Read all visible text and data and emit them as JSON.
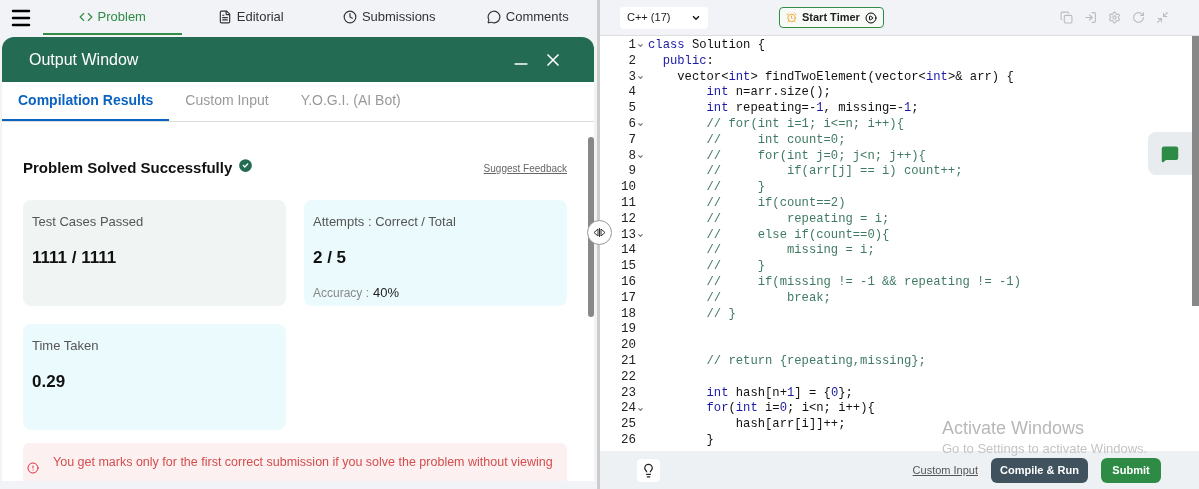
{
  "nav": {
    "tabs": [
      {
        "label": "Problem",
        "selected": true
      },
      {
        "label": "Editorial",
        "selected": false
      },
      {
        "label": "Submissions",
        "selected": false
      },
      {
        "label": "Comments",
        "selected": false
      }
    ]
  },
  "output_window": {
    "title": "Output Window",
    "tabs": [
      {
        "label": "Compilation Results",
        "selected": true
      },
      {
        "label": "Custom Input",
        "selected": false
      },
      {
        "label": "Y.O.G.I. (AI Bot)",
        "selected": false
      }
    ],
    "status": "Problem Solved Successfully",
    "feedback_link": "Suggest Feedback",
    "cards": [
      {
        "label": "Test Cases Passed",
        "value": "1111 / 1111"
      },
      {
        "label": "Attempts : Correct / Total",
        "value": "2 / 5",
        "extra_label": "Accuracy :",
        "extra_value": "40%"
      },
      {
        "label": "Time Taken",
        "value": "0.29"
      }
    ],
    "notice": "You get marks only for the first correct submission if you solve the problem without viewing"
  },
  "editor": {
    "language": "C++ (17)",
    "timer_button": "Start Timer",
    "lines": [
      {
        "number": "1",
        "fold": true,
        "tokens": [
          {
            "kind": "keyword",
            "text": "class"
          },
          {
            "kind": "plain",
            "text": " Solution {"
          }
        ]
      },
      {
        "number": "2",
        "fold": false,
        "tokens": [
          {
            "kind": "keyword",
            "text": "  public"
          },
          {
            "kind": "plain",
            "text": ":"
          }
        ]
      },
      {
        "number": "3",
        "fold": true,
        "tokens": [
          {
            "kind": "plain",
            "text": "    vector<"
          },
          {
            "kind": "keyword",
            "text": "int"
          },
          {
            "kind": "plain",
            "text": "> findTwoElement(vector<"
          },
          {
            "kind": "keyword",
            "text": "int"
          },
          {
            "kind": "plain",
            "text": ">& arr) {"
          }
        ]
      },
      {
        "number": "4",
        "fold": false,
        "tokens": [
          {
            "kind": "keyword",
            "text": "        int"
          },
          {
            "kind": "plain",
            "text": " n=arr.size();"
          }
        ]
      },
      {
        "number": "5",
        "fold": false,
        "tokens": [
          {
            "kind": "keyword",
            "text": "        int"
          },
          {
            "kind": "plain",
            "text": " repeating=-"
          },
          {
            "kind": "number",
            "text": "1"
          },
          {
            "kind": "plain",
            "text": ", missing=-"
          },
          {
            "kind": "number",
            "text": "1"
          },
          {
            "kind": "plain",
            "text": ";"
          }
        ]
      },
      {
        "number": "6",
        "fold": true,
        "tokens": [
          {
            "kind": "comment",
            "text": "        // for(int i=1; i<=n; i++){"
          }
        ]
      },
      {
        "number": "7",
        "fold": false,
        "tokens": [
          {
            "kind": "comment",
            "text": "        //     int count=0;"
          }
        ]
      },
      {
        "number": "8",
        "fold": true,
        "tokens": [
          {
            "kind": "comment",
            "text": "        //     for(int j=0; j<n; j++){"
          }
        ]
      },
      {
        "number": "9",
        "fold": false,
        "tokens": [
          {
            "kind": "comment",
            "text": "        //         if(arr[j] == i) count++;"
          }
        ]
      },
      {
        "number": "10",
        "fold": false,
        "tokens": [
          {
            "kind": "comment",
            "text": "        //     }"
          }
        ]
      },
      {
        "number": "11",
        "fold": false,
        "tokens": [
          {
            "kind": "comment",
            "text": "        //     if(count==2)"
          }
        ]
      },
      {
        "number": "12",
        "fold": false,
        "tokens": [
          {
            "kind": "comment",
            "text": "        //         repeating = i;"
          }
        ]
      },
      {
        "number": "13",
        "fold": true,
        "tokens": [
          {
            "kind": "comment",
            "text": "        //     else if(count==0){"
          }
        ]
      },
      {
        "number": "14",
        "fold": false,
        "tokens": [
          {
            "kind": "comment",
            "text": "        //         missing = i;"
          }
        ]
      },
      {
        "number": "15",
        "fold": false,
        "tokens": [
          {
            "kind": "comment",
            "text": "        //     }"
          }
        ]
      },
      {
        "number": "16",
        "fold": false,
        "tokens": [
          {
            "kind": "comment",
            "text": "        //     if(missing != -1 && repeating != -1)"
          }
        ]
      },
      {
        "number": "17",
        "fold": false,
        "tokens": [
          {
            "kind": "comment",
            "text": "        //         break;"
          }
        ]
      },
      {
        "number": "18",
        "fold": false,
        "tokens": [
          {
            "kind": "comment",
            "text": "        // }"
          }
        ]
      },
      {
        "number": "19",
        "fold": false
      },
      {
        "number": "20",
        "fold": false
      },
      {
        "number": "21",
        "fold": false,
        "tokens": [
          {
            "kind": "comment",
            "text": "        // return {repeating,missing};"
          }
        ]
      },
      {
        "number": "22",
        "fold": false
      },
      {
        "number": "23",
        "fold": false,
        "tokens": [
          {
            "kind": "keyword",
            "text": "        int"
          },
          {
            "kind": "plain",
            "text": " hash[n+"
          },
          {
            "kind": "number",
            "text": "1"
          },
          {
            "kind": "plain",
            "text": "] = {"
          },
          {
            "kind": "number",
            "text": "0"
          },
          {
            "kind": "plain",
            "text": "};"
          }
        ]
      },
      {
        "number": "24",
        "fold": true,
        "tokens": [
          {
            "kind": "keyword",
            "text": "        for"
          },
          {
            "kind": "plain",
            "text": "("
          },
          {
            "kind": "keyword",
            "text": "int"
          },
          {
            "kind": "plain",
            "text": " i="
          },
          {
            "kind": "number",
            "text": "0"
          },
          {
            "kind": "plain",
            "text": "; i<n; i++){"
          }
        ]
      },
      {
        "number": "25",
        "fold": false,
        "tokens": [
          {
            "kind": "plain",
            "text": "            hash[arr[i]]++;"
          }
        ]
      },
      {
        "number": "26",
        "fold": false,
        "tokens": [
          {
            "kind": "plain",
            "text": "        }"
          }
        ]
      }
    ],
    "custom_input_link": "Custom Input",
    "compile_button": "Compile & Run",
    "submit_button": "Submit"
  },
  "os_overlay": {
    "title": "Activate Windows",
    "subtitle": "Go to Settings to activate Windows."
  }
}
